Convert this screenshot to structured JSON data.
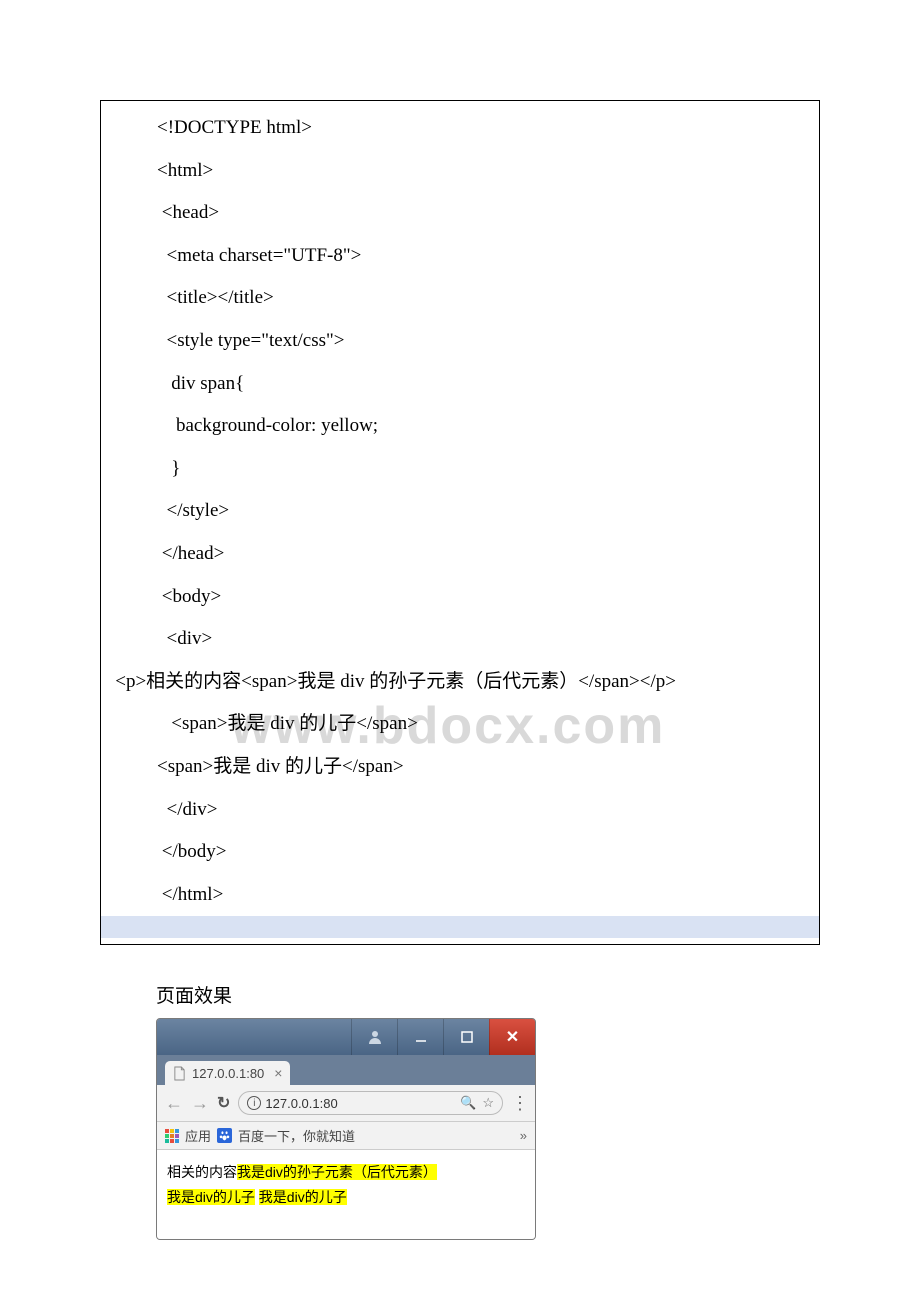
{
  "code": {
    "l1": "<!DOCTYPE html>",
    "l2": "<html>",
    "l3": " <head>",
    "l4": "  <meta charset=\"UTF-8\">",
    "l5": "  <title></title>",
    "l6": "  <style type=\"text/css\">",
    "l7": "   div span{",
    "l8": "    background-color: yellow;",
    "l9": "   }",
    "l10": "  </style>",
    "l11": " </head>",
    "l12": " <body>",
    "l13": "  <div>",
    "l14": "   <p>相关的内容<span>我是 div 的孙子元素（后代元素）</span></p>",
    "l15": "   <span>我是 div 的儿子</span>",
    "l16": "<span>我是 div 的儿子</span>",
    "l17": "  </div>",
    "l18": " </body>",
    "l19": " </html>"
  },
  "watermark": "www.bdocx.com",
  "caption": "页面效果",
  "browser": {
    "tab_title": "127.0.0.1:80",
    "url": "127.0.0.1:80",
    "apps_label": "应用",
    "bookmark_label": "百度一下，你就知道",
    "content": {
      "line1_plain": "相关的内容",
      "line1_hl": "我是div的孙子元素（后代元素）",
      "line2_hl_a": "我是div的儿子",
      "line2_hl_b": "我是div的儿子"
    }
  }
}
